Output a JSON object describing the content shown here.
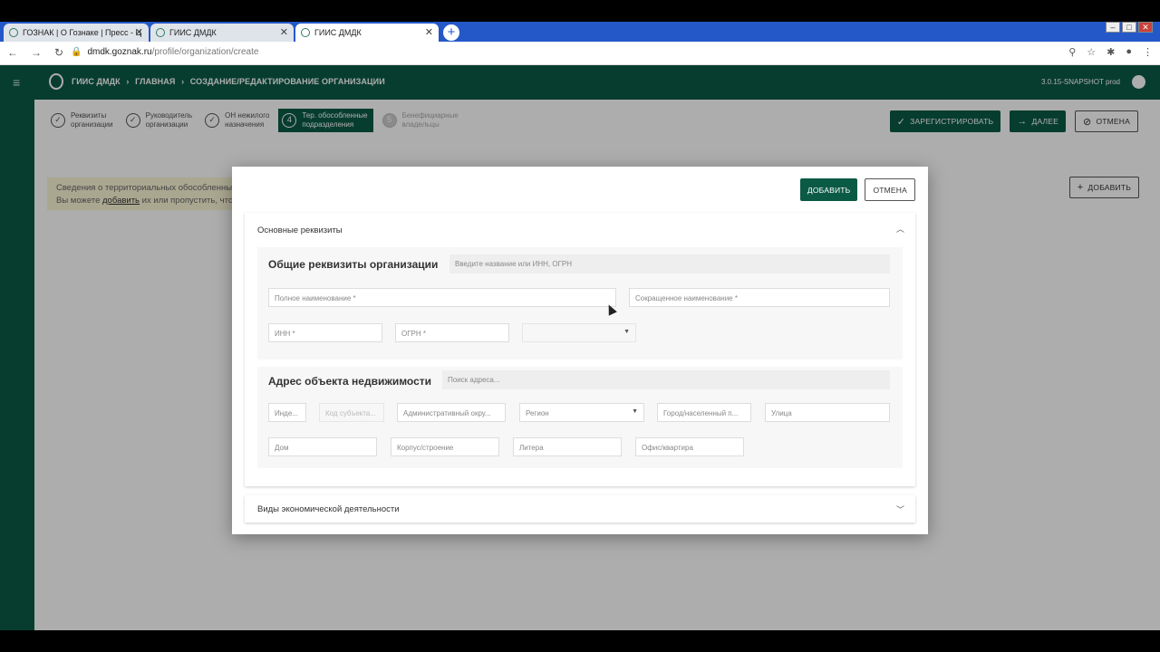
{
  "browser": {
    "tabs": [
      {
        "label": "ГОЗНАК | О Гознаке | Пресс - Ц"
      },
      {
        "label": "ГИИС ДМДК"
      },
      {
        "label": "ГИИС ДМДК"
      }
    ],
    "new_tab_icon": "+",
    "url_domain": "dmdk.goznak.ru",
    "url_path": "/profile/organization/create"
  },
  "header": {
    "menu_icon": "≡",
    "crumbs": [
      "ГИИС ДМДК",
      "ГЛАВНАЯ",
      "СОЗДАНИЕ/РЕДАКТИРОВАНИЕ ОРГАНИЗАЦИИ"
    ],
    "separator": "›",
    "version": "3.0.15-SNAPSHOT prod"
  },
  "stepper": [
    {
      "num": "✓",
      "label1": "Реквизиты",
      "label2": "организации"
    },
    {
      "num": "✓",
      "label1": "Руководитель",
      "label2": "организации"
    },
    {
      "num": "✓",
      "label1": "ОН нежилого",
      "label2": "назначения"
    },
    {
      "num": "4",
      "label1": "Тер. обособленные",
      "label2": "подразделения"
    },
    {
      "num": "5",
      "label1": "Бенефициарные",
      "label2": "владельцы"
    }
  ],
  "toolbar": {
    "register_label": "ЗАРЕГИСТРИРОВАТЬ",
    "next_label": "ДАЛЕЕ",
    "cancel_label": "ОТМЕНА",
    "add_label": "ДОБАВИТЬ"
  },
  "notice": {
    "line1": "Сведения о территориальных обособленных подразделениях отсутствуют.",
    "line2_pre": "Вы можете ",
    "line2_link": "добавить",
    "line2_post": " их или пропустить, чтобы"
  },
  "modal": {
    "add_label": "ДОБАВИТЬ",
    "cancel_label": "ОТМЕНА",
    "panel1_title": "Основные реквизиты",
    "section1_title": "Общие реквизиты организации",
    "section1_search_placeholder": "Введите название или ИНН, ОГРН",
    "full_name": "Полное наименование *",
    "short_name": "Сокращенное наименование *",
    "inn": "ИНН *",
    "ogrn": "ОГРН *",
    "section2_title": "Адрес объекта недвижимости",
    "address_search_placeholder": "Поиск адреса...",
    "index": "Инде...",
    "subject_code": "Код субъекта...",
    "admin_district": "Административный окру...",
    "region": "Регион",
    "city": "Город/населенный п...",
    "street": "Улица",
    "house": "Дом",
    "building": "Корпус/строение",
    "letter": "Литера",
    "office": "Офис/квартира",
    "panel2_title": "Виды экономической деятельности"
  }
}
